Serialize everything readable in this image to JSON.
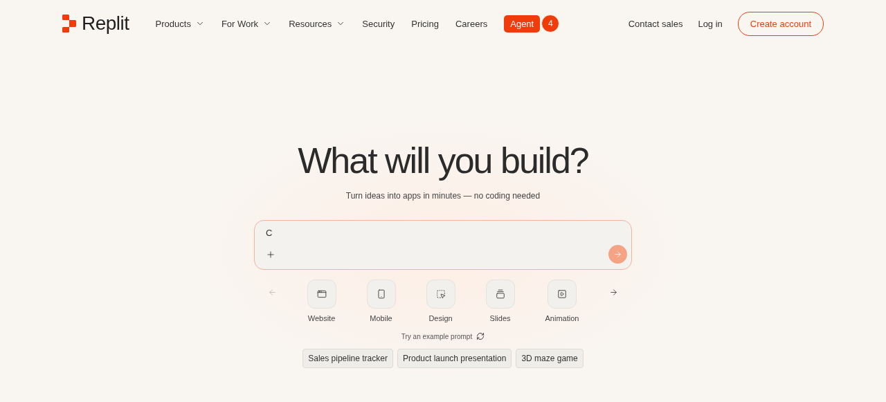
{
  "brand": {
    "name": "Replit"
  },
  "nav": [
    {
      "label": "Products",
      "dropdown": true
    },
    {
      "label": "For Work",
      "dropdown": true
    },
    {
      "label": "Resources",
      "dropdown": true
    },
    {
      "label": "Security",
      "dropdown": false
    },
    {
      "label": "Pricing",
      "dropdown": false
    },
    {
      "label": "Careers",
      "dropdown": false
    }
  ],
  "agent": {
    "label": "Agent",
    "badge": "4"
  },
  "actions": {
    "contact": "Contact sales",
    "login": "Log in",
    "signup": "Create account"
  },
  "hero": {
    "title": "What will you build?",
    "subtitle": "Turn ideas into apps in minutes — no coding needed"
  },
  "prompt": {
    "value": "C"
  },
  "carousel": {
    "prev_disabled": true,
    "next_disabled": false
  },
  "categories": [
    {
      "label": "Website",
      "kind": "website"
    },
    {
      "label": "Mobile",
      "kind": "mobile"
    },
    {
      "label": "Design",
      "kind": "design"
    },
    {
      "label": "Slides",
      "kind": "slides"
    },
    {
      "label": "Animation",
      "kind": "animation"
    }
  ],
  "examples": {
    "label": "Try an example prompt",
    "items": [
      "Sales pipeline tracker",
      "Product launch presentation",
      "3D maze game"
    ]
  }
}
